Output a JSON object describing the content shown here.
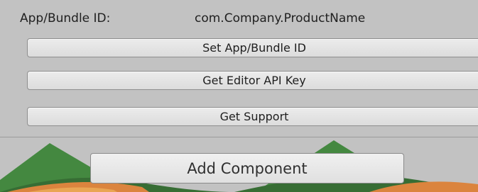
{
  "inspector": {
    "field_label": "App/Bundle ID:",
    "field_value": "com.Company.ProductName",
    "set_bundle_label": "Set App/Bundle ID",
    "get_key_label": "Get Editor API Key",
    "get_support_label": "Get Support",
    "add_component_label": "Add Component"
  },
  "colors": {
    "panel_bg": "#c2c2c2",
    "button_bg": "#e4e4e4",
    "watermark_green": "#2e7d2e",
    "watermark_orange": "#e07a28"
  }
}
